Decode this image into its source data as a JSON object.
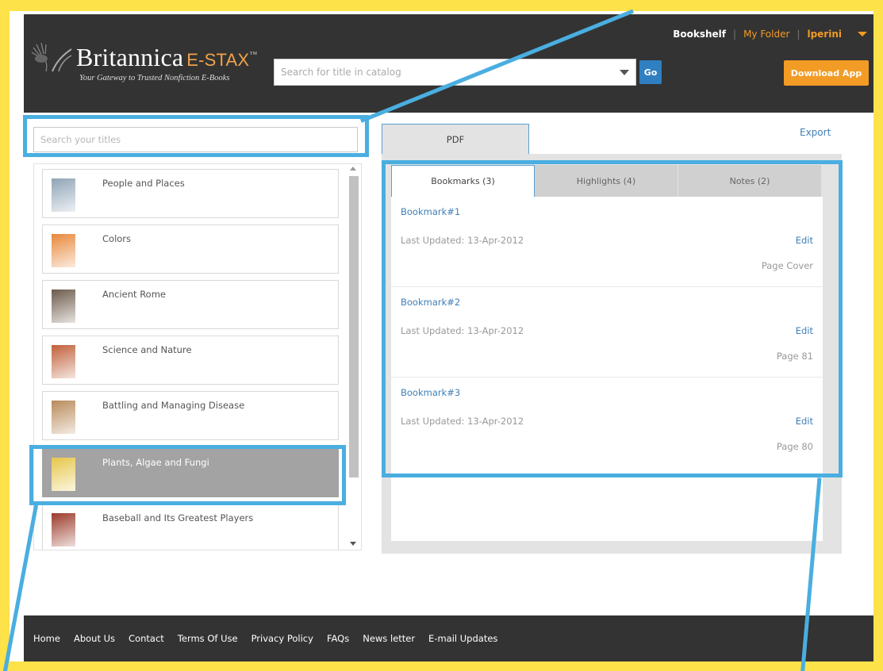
{
  "header": {
    "brand": "Britannica",
    "brand_suffix": "E-STAX",
    "trademark": "™",
    "tagline": "Your Gateway to Trusted Nonfiction E-Books",
    "catalog_search_placeholder": "Search for title in catalog",
    "go_label": "Go",
    "nav": {
      "bookshelf": "Bookshelf",
      "my_folder": "My Folder",
      "user": "lperini"
    },
    "download_label": "Download App"
  },
  "left": {
    "search_placeholder": "Search your titles",
    "titles": [
      {
        "title": "People and Places",
        "thumb_color": "#8fa4b6"
      },
      {
        "title": "Colors",
        "thumb_color": "#e8883a"
      },
      {
        "title": "Ancient Rome",
        "thumb_color": "#6c5a4a"
      },
      {
        "title": "Science and Nature",
        "thumb_color": "#c0603a"
      },
      {
        "title": "Battling and Managing Disease",
        "thumb_color": "#b88a5a"
      },
      {
        "title": "Plants, Algae and Fungi",
        "thumb_color": "#e6c64a",
        "selected": true
      },
      {
        "title": "Baseball and Its Greatest Players",
        "thumb_color": "#9a3a2a"
      }
    ]
  },
  "right": {
    "pdf_tab": "PDF",
    "export_label": "Export",
    "tabs": [
      "Bookmarks (3)",
      "Highlights (4)",
      "Notes (2)"
    ],
    "bookmarks": [
      {
        "title": "Bookmark#1",
        "updated": "Last Updated: 13-Apr-2012",
        "edit": "Edit",
        "page": "Page Cover"
      },
      {
        "title": "Bookmark#2",
        "updated": "Last Updated: 13-Apr-2012",
        "edit": "Edit",
        "page": "Page 81"
      },
      {
        "title": "Bookmark#3",
        "updated": "Last Updated: 13-Apr-2012",
        "edit": "Edit",
        "page": "Page 80"
      }
    ]
  },
  "footer": {
    "links": [
      "Home",
      "About Us",
      "Contact",
      "Terms Of Use",
      "Privacy Policy",
      "FAQs",
      "News letter",
      "E-mail Updates"
    ]
  },
  "colors": {
    "page_border": "#fde24a",
    "header_bg": "#333333",
    "accent_orange": "#f29b25",
    "link_blue": "#3f7fb7",
    "callout_blue": "#4aaee0",
    "selected_row": "#a3a3a3"
  }
}
